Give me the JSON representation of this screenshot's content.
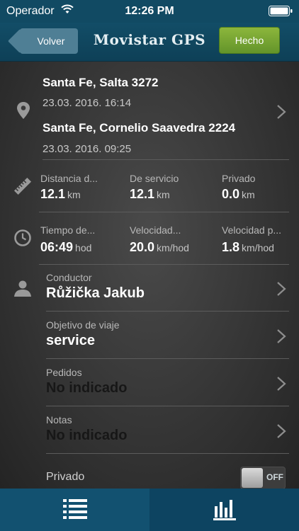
{
  "status_bar": {
    "carrier": "Operador",
    "time": "12:26 PM"
  },
  "nav": {
    "back_label": "Volver",
    "title": "Movistar GPS",
    "done_label": "Hecho"
  },
  "trip": {
    "end_address": "Santa Fe, Salta 3272",
    "end_time": "23.03. 2016. 16:14",
    "start_address": "Santa Fe, Cornelio Saavedra 2224",
    "start_time": "23.03. 2016. 09:25"
  },
  "distance": {
    "icon": "ruler-icon",
    "items": [
      {
        "label": "Distancia d...",
        "value": "12.1",
        "unit": "km"
      },
      {
        "label": "De servicio",
        "value": "12.1",
        "unit": "km"
      },
      {
        "label": "Privado",
        "value": "0.0",
        "unit": "km"
      }
    ]
  },
  "time_speed": {
    "icon": "clock-icon",
    "items": [
      {
        "label": "Tiempo de...",
        "value": "06:49",
        "unit": "hod"
      },
      {
        "label": "Velocidad...",
        "value": "20.0",
        "unit": "km/hod"
      },
      {
        "label": "Velocidad p...",
        "value": "1.8",
        "unit": "km/hod"
      }
    ]
  },
  "fields": {
    "driver": {
      "label": "Conductor",
      "value": "Růžička Jakub"
    },
    "purpose": {
      "label": "Objetivo de viaje",
      "value": "service"
    },
    "orders": {
      "label": "Pedidos",
      "value": "No indicado"
    },
    "notes": {
      "label": "Notas",
      "value": "No indicado"
    }
  },
  "private_toggle": {
    "label": "Privado",
    "state": "OFF"
  },
  "colors": {
    "nav_background": "#114a63",
    "done_button": "#7aa832",
    "tab_bar": "#125170"
  }
}
